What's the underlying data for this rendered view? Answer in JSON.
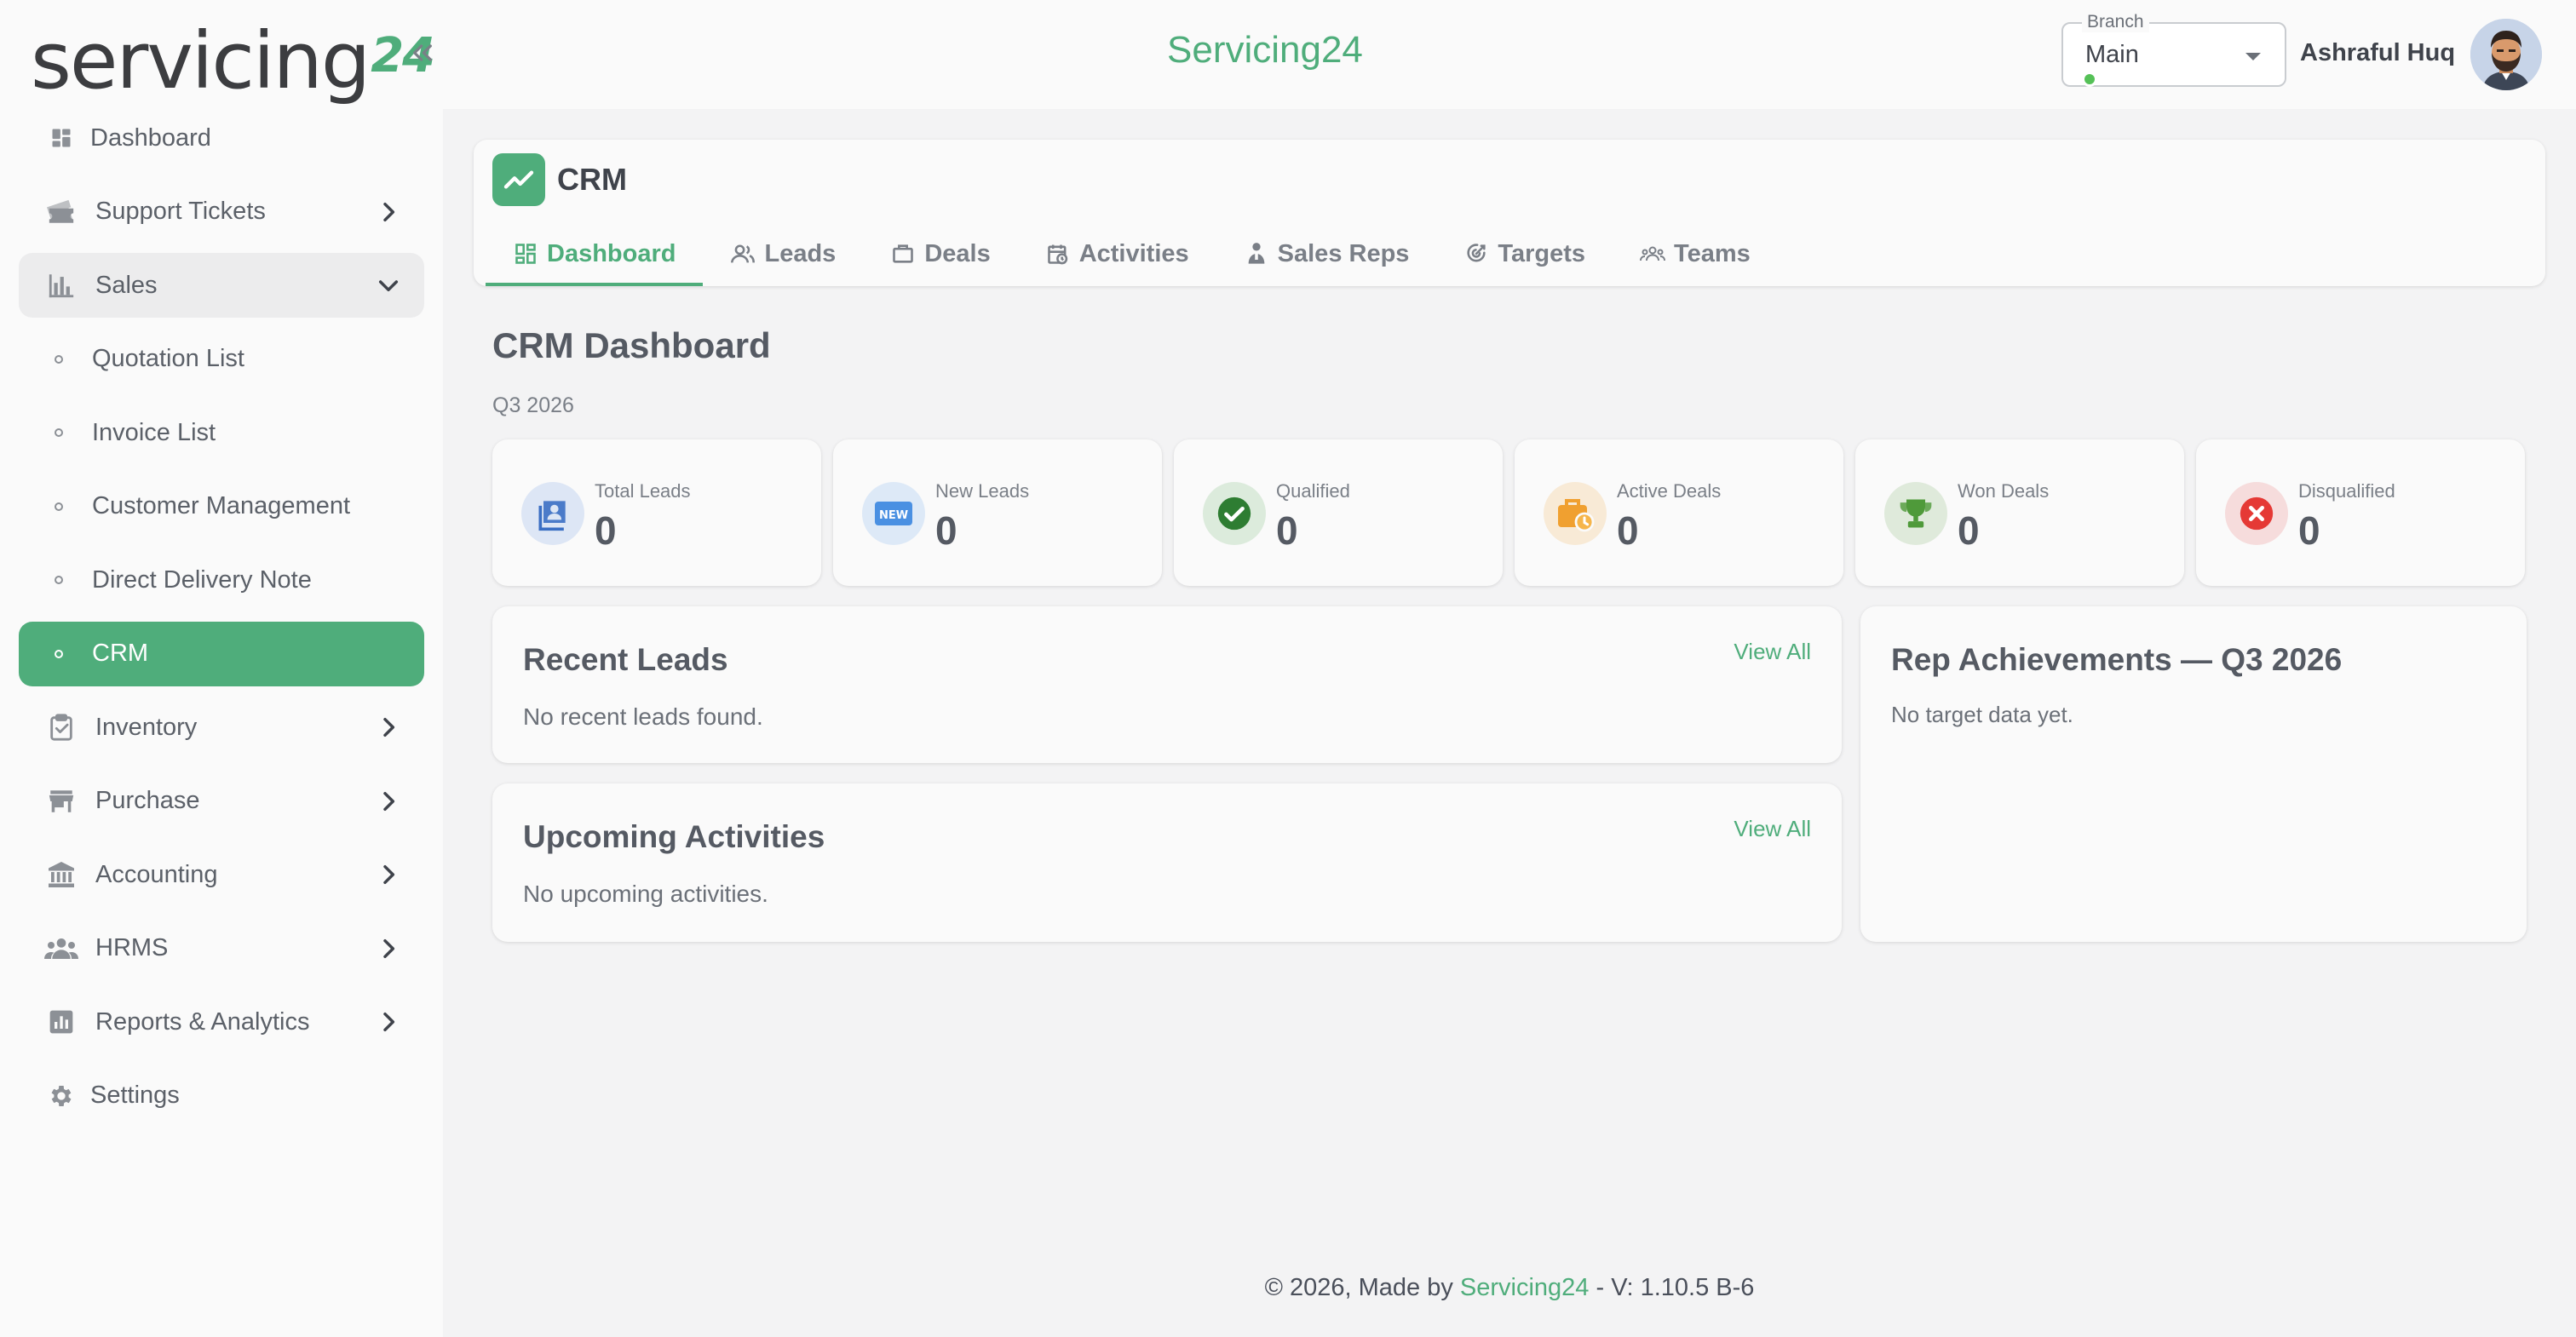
{
  "app": {
    "logo_text": "servicing",
    "logo_accent": "24",
    "title": "Servicing24",
    "accent_color": "#4fad7b"
  },
  "header": {
    "branch_label": "Branch",
    "branch_value": "Main",
    "user_name": "Ashraful Huq"
  },
  "sidebar": {
    "items": [
      {
        "label": "Dashboard",
        "icon": "dashboard-icon"
      },
      {
        "label": "Support Tickets",
        "icon": "ticket-icon"
      },
      {
        "label": "Sales",
        "icon": "bar-chart-icon"
      },
      {
        "label": "Quotation List"
      },
      {
        "label": "Invoice List"
      },
      {
        "label": "Customer Management"
      },
      {
        "label": "Direct Delivery Note"
      },
      {
        "label": "CRM"
      },
      {
        "label": "Inventory",
        "icon": "clipboard-check-icon"
      },
      {
        "label": "Purchase",
        "icon": "store-icon"
      },
      {
        "label": "Accounting",
        "icon": "bank-icon"
      },
      {
        "label": "HRMS",
        "icon": "people-icon"
      },
      {
        "label": "Reports & Analytics",
        "icon": "analytics-icon"
      },
      {
        "label": "Settings",
        "icon": "gear-icon"
      }
    ]
  },
  "crm": {
    "title": "CRM",
    "tabs": [
      {
        "label": "Dashboard"
      },
      {
        "label": "Leads"
      },
      {
        "label": "Deals"
      },
      {
        "label": "Activities"
      },
      {
        "label": "Sales Reps"
      },
      {
        "label": "Targets"
      },
      {
        "label": "Teams"
      }
    ]
  },
  "page": {
    "title": "CRM Dashboard",
    "period": "Q3 2026"
  },
  "stats": [
    {
      "label": "Total Leads",
      "value": "0",
      "color": "#3b6fc4"
    },
    {
      "label": "New Leads",
      "value": "0",
      "color": "#4a90e2"
    },
    {
      "label": "Qualified",
      "value": "0",
      "color": "#2e7d32"
    },
    {
      "label": "Active Deals",
      "value": "0",
      "color": "#f0a030"
    },
    {
      "label": "Won Deals",
      "value": "0",
      "color": "#4f9a3a"
    },
    {
      "label": "Disqualified",
      "value": "0",
      "color": "#e53935"
    }
  ],
  "recent_leads": {
    "title": "Recent Leads",
    "view_all": "View All",
    "empty": "No recent leads found."
  },
  "upcoming_activities": {
    "title": "Upcoming Activities",
    "view_all": "View All",
    "empty": "No upcoming activities."
  },
  "rep_achievements": {
    "title": "Rep Achievements — Q3 2026",
    "empty": "No target data yet."
  },
  "footer": {
    "prefix": "© 2026, Made by",
    "brand": "Servicing24",
    "version": "- V: 1.10.5 B-6"
  }
}
